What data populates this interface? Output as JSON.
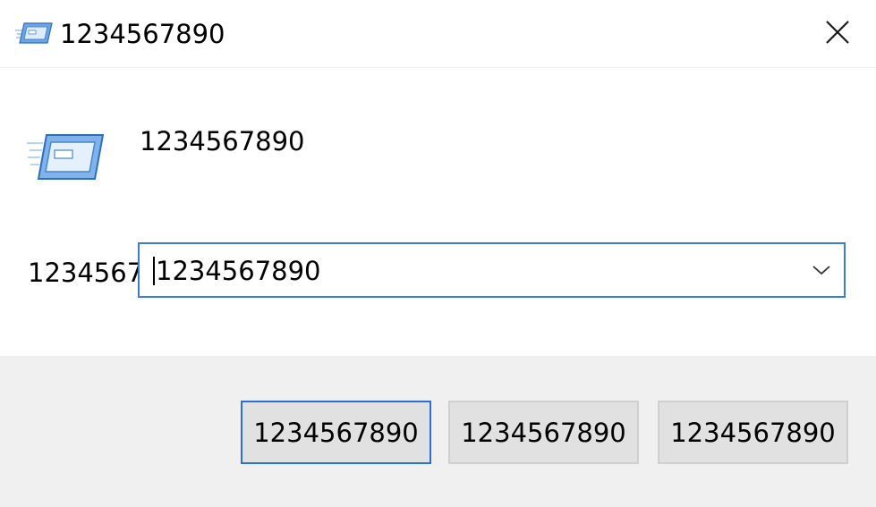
{
  "window": {
    "title": "1234567890",
    "icon": "run-dialog-icon",
    "close_icon": "close-icon"
  },
  "dialog": {
    "message": "1234567890",
    "icon": "run-dialog-icon",
    "open_label": "1234567",
    "combo": {
      "value": "1234567890",
      "arrow_icon": "chevron-down-icon"
    }
  },
  "buttons": {
    "ok": "1234567890",
    "cancel": "1234567890",
    "browse": "1234567890"
  },
  "colors": {
    "accent": "#3a7bd5",
    "footer_bg": "#f0f0f0",
    "button_bg": "#e1e1e1"
  }
}
